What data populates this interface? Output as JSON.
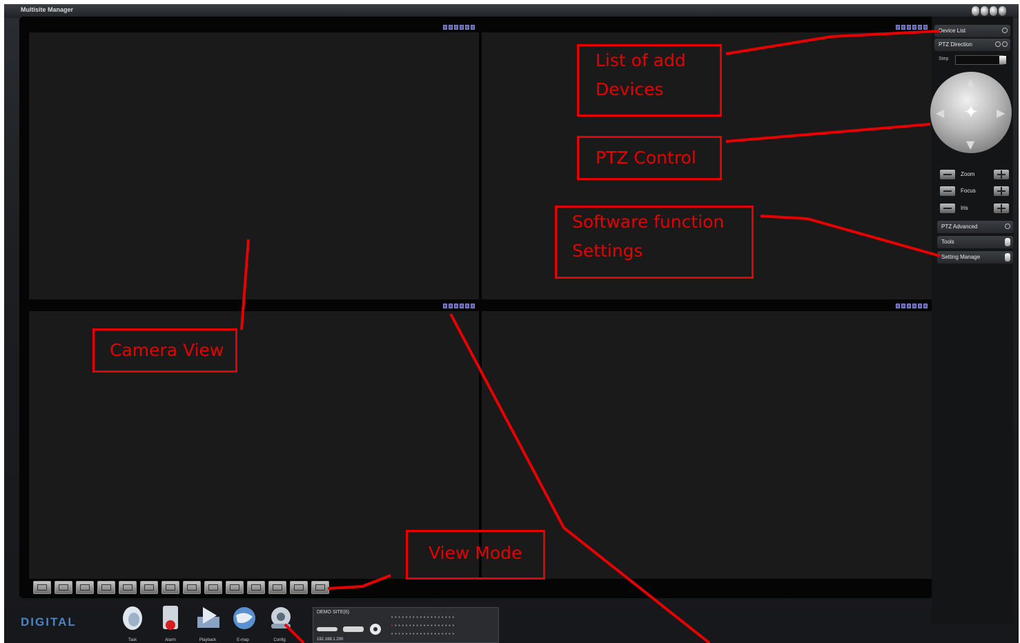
{
  "window": {
    "title": "Multisite Manager",
    "controls": [
      "minimize-icon",
      "restore-icon",
      "maximize-icon",
      "close-icon"
    ]
  },
  "panes": [
    {
      "name": "camera-pane-1",
      "toolbar_icons": 6
    },
    {
      "name": "camera-pane-2",
      "toolbar_icons": 6
    },
    {
      "name": "camera-pane-3",
      "toolbar_icons": 6
    },
    {
      "name": "camera-pane-4",
      "toolbar_icons": 6
    }
  ],
  "view_mode_buttons": 14,
  "right_panel": {
    "device_list": "Device List",
    "ptz_direction": "PTZ Direction",
    "step_label": "Step",
    "zoom": "Zoom",
    "focus": "Focus",
    "iris": "Iris",
    "ptz_advanced": "PTZ Advanced",
    "tools": "Tools",
    "setting_manage": "Setting Manage"
  },
  "bottom": {
    "logo": "DIGITAL",
    "buttons": [
      {
        "label": "Task",
        "icon": "task-icon"
      },
      {
        "label": "Alarm",
        "icon": "alarm-icon"
      },
      {
        "label": "Playback",
        "icon": "playback-icon"
      },
      {
        "label": "E-map",
        "icon": "globe-icon"
      },
      {
        "label": "Config",
        "icon": "config-icon"
      }
    ],
    "device": {
      "name": "DEMO SITE(6)",
      "ip": "192.168.1.200"
    }
  },
  "annotations": {
    "list_devices_line1": "List of add",
    "list_devices_line2": "Devices",
    "ptz_control": "PTZ Control",
    "software_settings_line1": "Software function",
    "software_settings_line2": "Settings",
    "camera_view": "Camera View",
    "view_mode": "View Mode"
  },
  "colors": {
    "annotation": "#e60000",
    "background": "#17181b",
    "pane": "#1a1a1a"
  }
}
